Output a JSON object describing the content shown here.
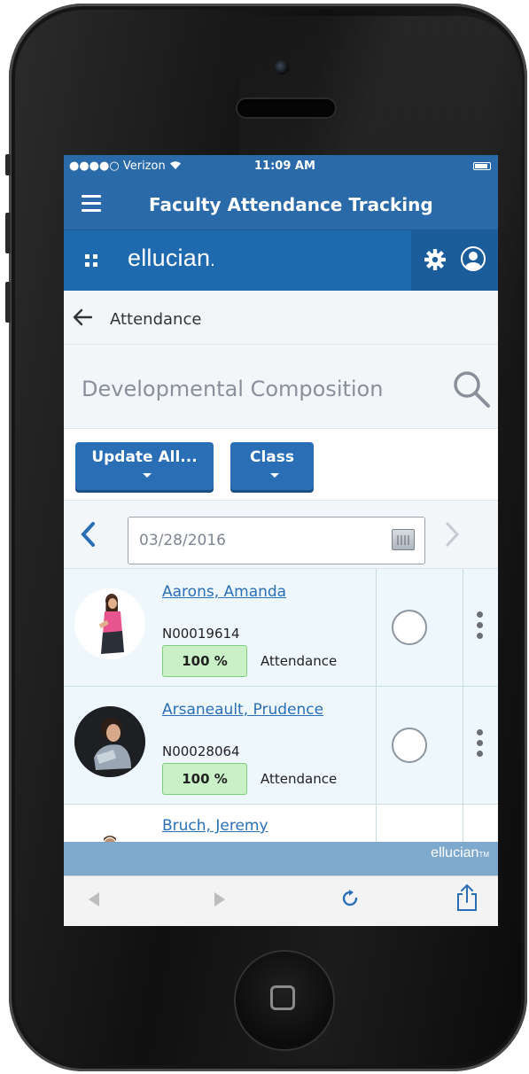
{
  "status_bar": {
    "carrier": "●●●●○ Verizon",
    "time": "11:09 AM"
  },
  "app_bar": {
    "title": "Faculty Attendance Tracking"
  },
  "brand_bar": {
    "brand": "ellucian",
    "brand_dot": "."
  },
  "nav": {
    "back_label": "Attendance"
  },
  "course": {
    "title": "Developmental Composition"
  },
  "actions": {
    "update_all_label": "Update All...",
    "class_label": "Class"
  },
  "date_picker": {
    "value": "03/28/2016"
  },
  "students": [
    {
      "name": "Aarons, Amanda",
      "id": "N00019614",
      "attendance_pct": "100 %",
      "attendance_label": "Attendance"
    },
    {
      "name": "Arsaneault, Prudence",
      "id": "N00028064",
      "attendance_pct": "100 %",
      "attendance_label": "Attendance"
    },
    {
      "name": "Bruch, Jeremy"
    }
  ],
  "footer": {
    "brand": "ellucian",
    "trademark": "TM"
  },
  "colors": {
    "primary": "#2a6aa8",
    "button": "#2a6fb6",
    "badge_green": "#c9f0c6",
    "row_bg": "#eef7fb"
  },
  "icons": {
    "menu": "hamburger-menu-icon",
    "apps": "grid-icon",
    "settings": "gear-icon",
    "profile": "user-icon",
    "back": "arrow-left-icon",
    "search": "search-icon",
    "calendar": "calendar-icon",
    "more": "vertical-dots-icon",
    "reload": "reload-icon",
    "share": "share-icon"
  }
}
